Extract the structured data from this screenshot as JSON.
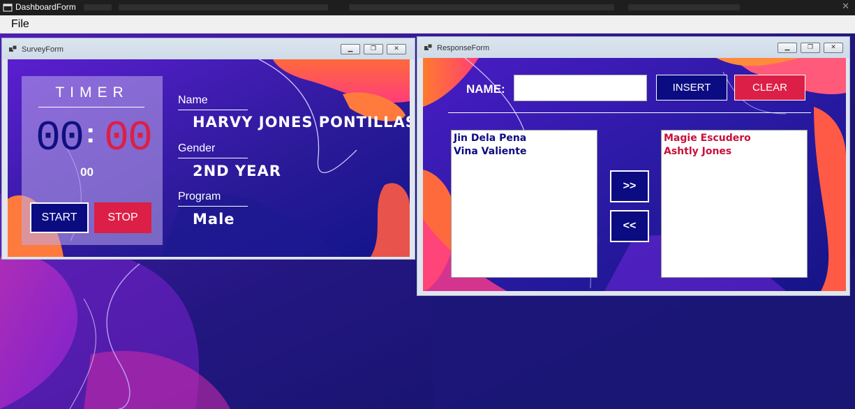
{
  "app": {
    "title": "DashboardForm",
    "menu": {
      "file": "File"
    }
  },
  "survey_form": {
    "title": "SurveyForm",
    "timer": {
      "title": "TIMER",
      "minutes": "00",
      "separator": ":",
      "seconds": "00",
      "milliseconds": "00"
    },
    "buttons": {
      "start": "START",
      "stop": "STOP"
    },
    "fields": [
      {
        "label": "Name",
        "value": "HARVY JONES PONTILLAS"
      },
      {
        "label": "Gender",
        "value": "2ND YEAR"
      },
      {
        "label": "Program",
        "value": "Male"
      }
    ]
  },
  "response_form": {
    "title": "ResponseForm",
    "name_label": "NAME:",
    "name_value": "",
    "buttons": {
      "insert": "INSERT",
      "clear": "CLEAR",
      "move_right": ">>",
      "move_left": "<<"
    },
    "left_list": [
      "Jin Dela Pena",
      "Vina Valiente"
    ],
    "right_list": [
      "Magie Escudero",
      "Ashtly Jones"
    ]
  },
  "colors": {
    "navy": "#0c0c82",
    "crimson": "#dc1f46",
    "background_purple": "#5a1fc0"
  },
  "icons": {
    "app": "form-icon",
    "minimize": "minimize-icon",
    "restore": "restore-icon",
    "close": "close-icon"
  }
}
